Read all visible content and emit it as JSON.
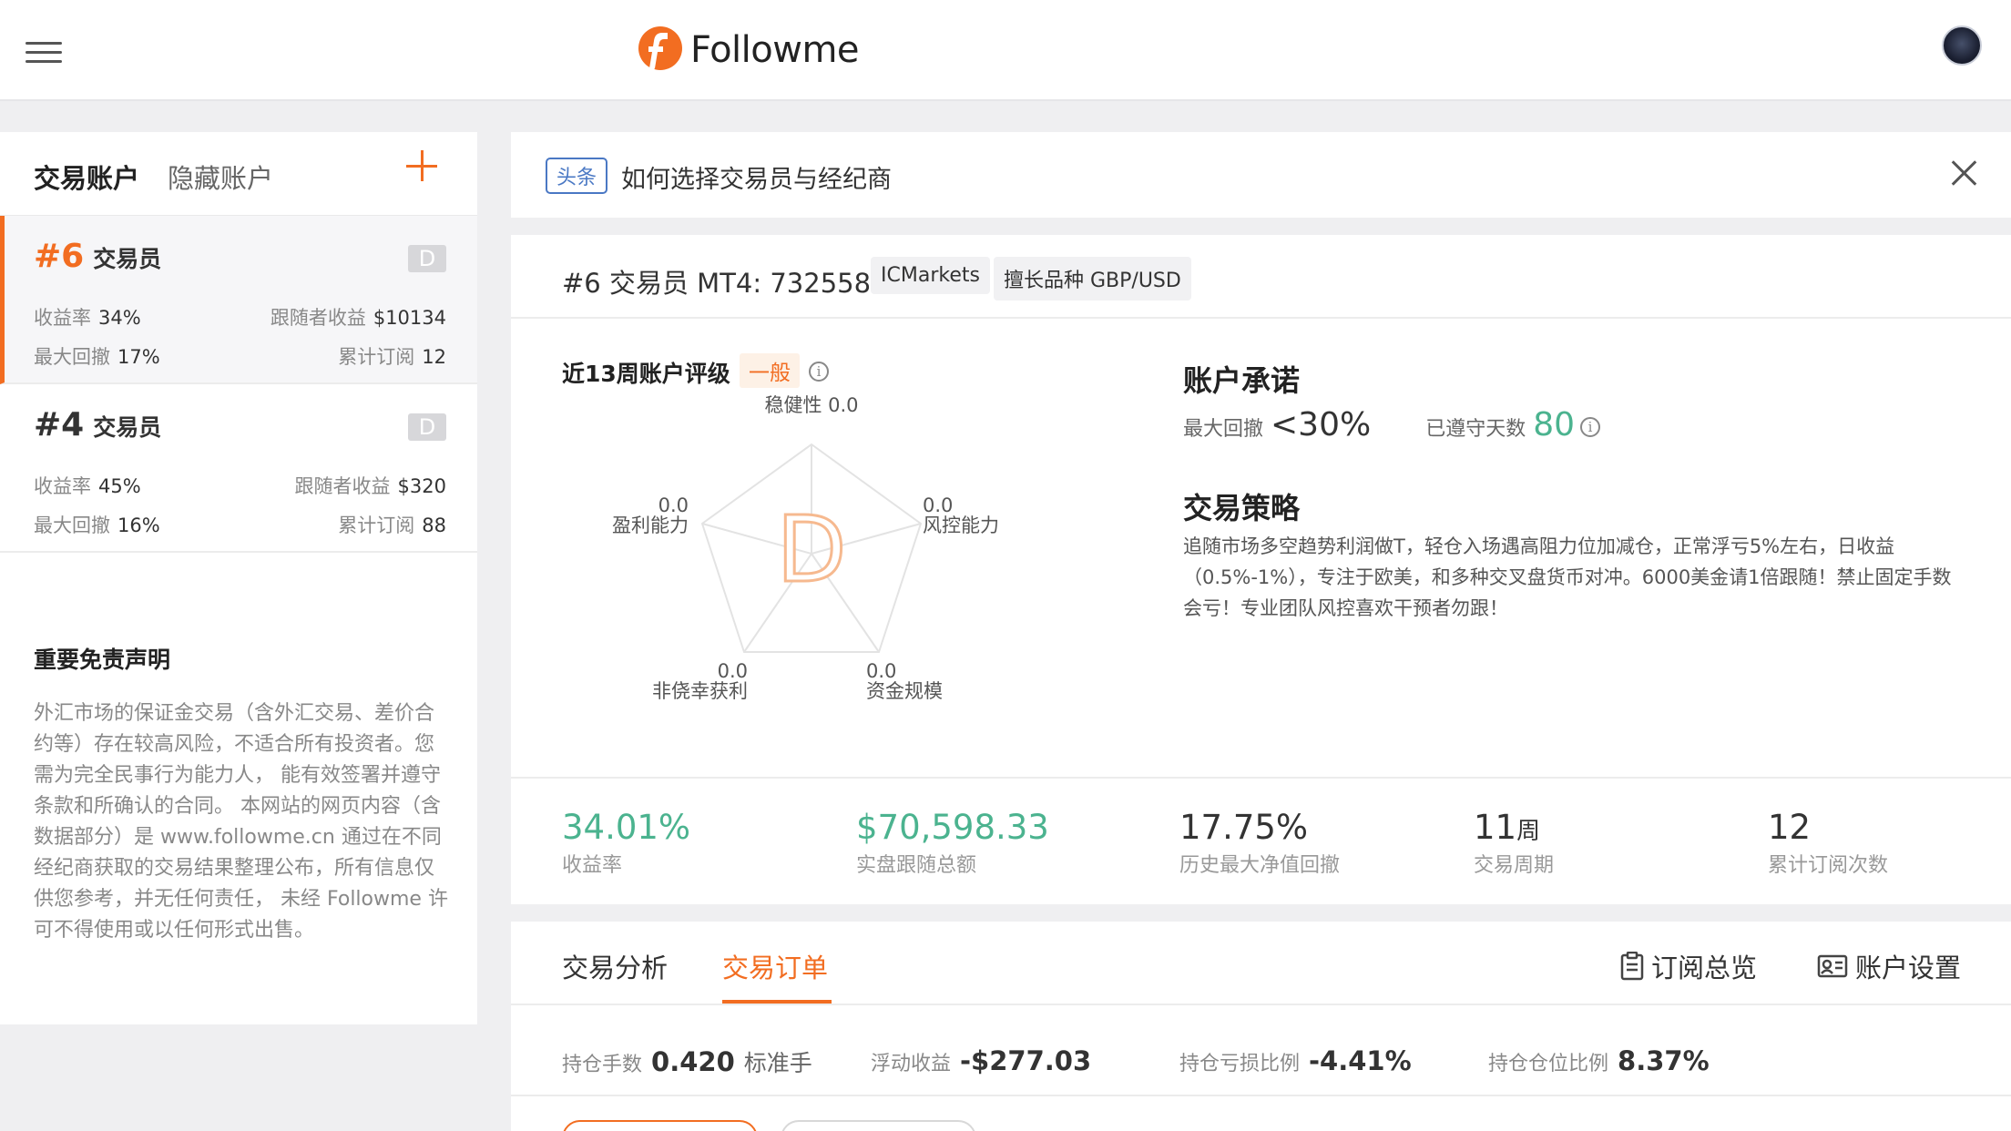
{
  "header": {
    "brand": "Followme",
    "colors": {
      "accent": "#f26d21",
      "green": "#4bb38f",
      "blue_tag": "#4a78c4"
    }
  },
  "left": {
    "tabs": [
      "交易账户",
      "隐藏账户"
    ],
    "accounts": [
      {
        "num": "#6",
        "role": "交易员",
        "badge": "D",
        "rate_label": "收益率",
        "rate": "34%",
        "follower_label": "跟随者收益",
        "follower": "$10134",
        "dd_label": "最大回撤",
        "dd": "17%",
        "subs_label": "累计订阅",
        "subs": "12"
      },
      {
        "num": "#4",
        "role": "交易员",
        "badge": "D",
        "rate_label": "收益率",
        "rate": "45%",
        "follower_label": "跟随者收益",
        "follower": "$320",
        "dd_label": "最大回撤",
        "dd": "16%",
        "subs_label": "累计订阅",
        "subs": "88"
      }
    ],
    "disclaimer": {
      "title": "重要免责声明",
      "body": "外汇市场的保证金交易（含外汇交易、差价合约等）存在较高风险，不适合所有投资者。您需为完全民事行为能力人， 能有效签署并遵守条款和所确认的合同。 本网站的网页内容（含数据部分）是 www.followme.cn 通过在不同经纪商获取的交易结果整理公布，所有信息仅供您参考，并无任何责任， 未经 Followme 许可不得使用或以任何形式出售。"
    }
  },
  "news": {
    "tag": "头条",
    "text": "如何选择交易员与经纪商"
  },
  "trader": {
    "title": "#6 交易员  MT4: 732558",
    "broker": "ICMarkets",
    "specialty": "擅长品种 GBP/USD",
    "rating": {
      "title": "近13周账户评级",
      "level": "一般",
      "grade": "D",
      "axes": [
        {
          "name": "稳健性",
          "value": "0.0"
        },
        {
          "name": "风控能力",
          "value": "0.0"
        },
        {
          "name": "资金规模",
          "value": "0.0"
        },
        {
          "name": "非侥幸获利",
          "value": "0.0"
        },
        {
          "name": "盈利能力",
          "value": "0.0"
        }
      ]
    },
    "promise": {
      "title": "账户承诺",
      "dd_label": "最大回撤",
      "dd_value": "<30%",
      "days_label": "已遵守天数",
      "days_value": "80"
    },
    "strategy": {
      "title": "交易策略",
      "body": "追随市场多空趋势利润做T，轻仓入场遇高阻力位加减仓，正常浮亏5%左右，日收益（0.5%-1%），专注于欧美，和多种交叉盘货币对冲。6000美金请1倍跟随！禁止固定手数会亏！专业团队风控喜欢干预者勿跟！"
    },
    "metrics": [
      {
        "value": "34.01%",
        "label": "收益率"
      },
      {
        "value": "$70,598.33",
        "label": "实盘跟随总额"
      },
      {
        "value": "17.75%",
        "label": "历史最大净值回撤"
      },
      {
        "value": "11",
        "unit": "周",
        "label": "交易周期"
      },
      {
        "value": "12",
        "label": "累计订阅次数"
      }
    ]
  },
  "orders": {
    "tabs": [
      "交易分析",
      "交易订单"
    ],
    "actions": [
      "订阅总览",
      "账户设置"
    ],
    "position": [
      {
        "label": "持仓手数",
        "value": "0.420",
        "unit": "标准手"
      },
      {
        "label": "浮动收益",
        "value": "-$277.03"
      },
      {
        "label": "持仓亏损比例",
        "value": "-4.41%"
      },
      {
        "label": "持仓仓位比例",
        "value": "8.37%"
      }
    ]
  }
}
